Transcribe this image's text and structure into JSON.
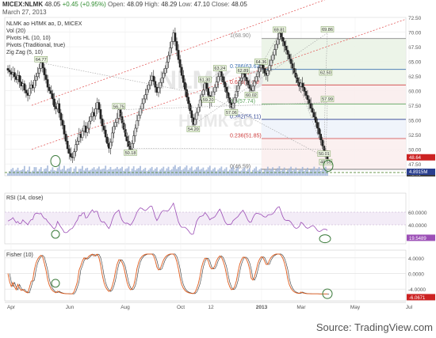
{
  "header": {
    "symbol": "MICEX:NLMK",
    "last": "48.05",
    "change": "+0.45 (+0.95%)",
    "open_label": "Open:",
    "open": "48.09",
    "high_label": "High:",
    "high": "48.29",
    "low_label": "Low:",
    "low": "47.10",
    "close_label": "Close:",
    "close": "48.05",
    "date": "March 27, 2013"
  },
  "legend": [
    "NLMK ao НЛМК ао, D, MICEX",
    "Vol (20)",
    "Pivots HL (10, 10)",
    "Pivots (Traditional, true)",
    "Zig Zag (5, 10)"
  ],
  "watermark": "NLMK, D",
  "watermark2": "НЛМК ао",
  "source": "Source: TradingView.com",
  "colors": {
    "up": "#2e7d32",
    "down": "#c62828",
    "candle": "#222222",
    "channel": "#e04a4a",
    "rsi": "#9c4fb6",
    "fisher_a": "#e05a1a",
    "fisher_b": "#333333",
    "last_badge": "#cc2222",
    "vol_badge": "#2a3f8f",
    "fib_blue": "#3a6fb0"
  },
  "chart_data": [
    {
      "type": "candlestick",
      "title": "NLMK ao НЛМК ао, D, MICEX",
      "ylim": [
        45.5,
        72.5
      ],
      "y_ticks": [
        "72.50",
        "70.00",
        "67.50",
        "65.00",
        "62.50",
        "60.00",
        "57.50",
        "55.00",
        "52.50",
        "50.00",
        "47.50"
      ],
      "x_ticks": [
        "Apr",
        "Jun",
        "Aug",
        "Oct",
        "12",
        "2013",
        "Mar",
        "May",
        "Jul"
      ],
      "last_price": "48.05",
      "last_badge": "48.64",
      "volume_badge": "4.8915M",
      "pivot_labels": [
        {
          "label": "64.77",
          "value": 64.77,
          "kind": "high"
        },
        {
          "label": "59.20",
          "value": 59.2,
          "kind": "low"
        },
        {
          "label": "48.59",
          "value": 48.59,
          "kind": "low"
        },
        {
          "label": "57.99",
          "value": 57.99,
          "kind": "high"
        },
        {
          "label": "56.75",
          "value": 56.75,
          "kind": "high"
        },
        {
          "label": "50.18",
          "value": 50.18,
          "kind": "low"
        },
        {
          "label": "50.01",
          "value": 50.01,
          "kind": "low"
        },
        {
          "label": "62.50",
          "value": 62.5,
          "kind": "high"
        },
        {
          "label": "69.86",
          "value": 69.86,
          "kind": "high"
        },
        {
          "label": "54.20",
          "value": 54.2,
          "kind": "low"
        },
        {
          "label": "61.30",
          "value": 61.3,
          "kind": "high"
        },
        {
          "label": "63.24",
          "value": 63.24,
          "kind": "high"
        },
        {
          "label": "57.06",
          "value": 57.06,
          "kind": "low"
        },
        {
          "label": "62.89",
          "value": 62.89,
          "kind": "high"
        },
        {
          "label": "60.02",
          "value": 60.02,
          "kind": "low"
        },
        {
          "label": "64.36",
          "value": 64.36,
          "kind": "high"
        },
        {
          "label": "69.81",
          "value": 69.81,
          "kind": "high"
        }
      ],
      "fib_levels": [
        {
          "label": "1(68.90)",
          "value": 68.9
        },
        {
          "label": "0.786(63.63)",
          "value": 63.63
        },
        {
          "label": "0.618(60.98)",
          "value": 60.98
        },
        {
          "label": "0.5(57.74)",
          "value": 57.74
        },
        {
          "label": "0.382(55.11)",
          "value": 55.11
        },
        {
          "label": "0.236(51.85)",
          "value": 51.85
        },
        {
          "label": "0(46.59)",
          "value": 46.59
        }
      ],
      "closes": [
        63.5,
        63.2,
        62.8,
        63.1,
        62.4,
        61.9,
        62.6,
        61.5,
        60.8,
        61.2,
        60.1,
        59.6,
        59.2,
        60.4,
        61.0,
        60.5,
        61.8,
        62.4,
        63.0,
        63.8,
        64.77,
        63.9,
        62.7,
        61.9,
        60.6,
        60.0,
        59.5,
        58.6,
        57.3,
        56.9,
        57.8,
        56.2,
        55.0,
        54.1,
        52.6,
        51.4,
        50.1,
        49.3,
        48.7,
        48.59,
        49.6,
        50.8,
        51.4,
        52.6,
        52.0,
        53.1,
        54.0,
        52.9,
        53.6,
        54.8,
        55.6,
        56.3,
        55.7,
        56.9,
        57.99,
        56.8,
        55.2,
        54.0,
        53.3,
        52.1,
        51.0,
        50.18,
        51.2,
        52.8,
        53.9,
        54.6,
        55.3,
        56.75,
        55.6,
        54.5,
        53.4,
        52.2,
        51.4,
        50.5,
        50.01,
        51.0,
        52.3,
        53.6,
        54.9,
        55.8,
        56.9,
        57.8,
        58.6,
        59.3,
        60.2,
        61.0,
        61.8,
        62.5,
        61.6,
        60.6,
        59.7,
        60.5,
        61.4,
        62.2,
        63.0,
        63.8,
        64.9,
        66.0,
        67.3,
        68.4,
        69.86,
        68.4,
        66.9,
        65.3,
        64.0,
        62.6,
        61.4,
        60.2,
        58.9,
        57.8,
        56.6,
        55.4,
        54.2,
        55.1,
        56.3,
        57.2,
        58.4,
        59.3,
        60.1,
        61.3,
        60.4,
        59.2,
        58.0,
        58.9,
        59.8,
        60.6,
        61.5,
        62.4,
        63.24,
        62.4,
        61.5,
        60.6,
        59.7,
        58.8,
        57.9,
        57.06,
        57.9,
        58.8,
        59.9,
        60.8,
        61.7,
        62.2,
        62.89,
        62.3,
        61.7,
        61.0,
        60.4,
        60.02,
        60.8,
        61.6,
        62.4,
        63.2,
        63.9,
        64.36,
        63.8,
        63.0,
        62.6,
        63.4,
        64.3,
        65.2,
        66.1,
        67.0,
        67.9,
        68.8,
        69.81,
        69.1,
        68.4,
        67.6,
        66.9,
        66.2,
        65.4,
        64.6,
        63.8,
        63.0,
        62.2,
        61.4,
        60.7,
        61.3,
        60.6,
        59.9,
        59.2,
        58.5,
        57.8,
        57.0,
        56.3,
        55.5,
        54.6,
        53.6,
        52.6,
        51.6,
        50.6,
        49.6,
        48.8,
        48.05
      ]
    },
    {
      "type": "line",
      "title": "RSI (14, close)",
      "y_ticks": [
        "60.0000",
        "40.0000"
      ],
      "last_badge": "19.5489",
      "ylim": [
        10,
        90
      ]
    },
    {
      "type": "line",
      "title": "Fisher (10)",
      "y_ticks": [
        "4.0000",
        "0.0000",
        "-4.0000"
      ],
      "last_badge": "-6.0671",
      "ylim": [
        -7,
        6
      ]
    }
  ]
}
